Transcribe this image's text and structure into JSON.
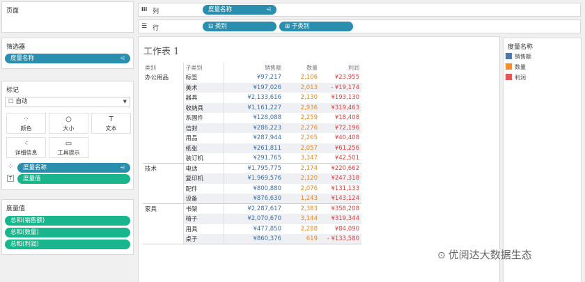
{
  "pages": {
    "title": "页面"
  },
  "filters": {
    "title": "筛选器",
    "pill": "度量名称",
    "sort": "⩤"
  },
  "marks": {
    "title": "标记",
    "type": "自动",
    "type_icon": "☐",
    "buttons": [
      {
        "label": "颜色",
        "icon": "⁘"
      },
      {
        "label": "大小",
        "icon": "○"
      },
      {
        "label": "文本",
        "icon": "T"
      },
      {
        "label": "详细信息",
        "icon": "⁖"
      },
      {
        "label": "工具提示",
        "icon": "▭"
      }
    ],
    "fields": [
      {
        "label": "度量名称",
        "icon": "⁘",
        "sort": "⩤"
      },
      {
        "label": "度量值",
        "icon": "T"
      }
    ]
  },
  "measure_values": {
    "title": "度量值",
    "items": [
      "总和(销售额)",
      "总和(数量)",
      "总和(利润)"
    ]
  },
  "shelves": {
    "columns": {
      "icon": "iii",
      "label": "列",
      "pills": [
        {
          "label": "度量名称",
          "sort": "⩤"
        }
      ]
    },
    "rows": {
      "icon": "☰",
      "label": "行",
      "pills": [
        {
          "label": "⊟ 类别"
        },
        {
          "label": "⊞ 子类别"
        }
      ]
    }
  },
  "sheet": {
    "title": "工作表 1",
    "headers": {
      "category": "类别",
      "subcategory": "子类别",
      "sales": "销售额",
      "quantity": "数量",
      "profit": "利润"
    },
    "groups": [
      {
        "category": "办公用品",
        "rows": [
          {
            "sub": "标签",
            "sales": "¥97,217",
            "qty": "2,106",
            "profit": "¥23,955"
          },
          {
            "sub": "美术",
            "sales": "¥197,026",
            "qty": "2,013",
            "profit": "- ¥19,174"
          },
          {
            "sub": "器具",
            "sales": "¥2,133,616",
            "qty": "2,130",
            "profit": "¥193,130"
          },
          {
            "sub": "收纳具",
            "sales": "¥1,161,227",
            "qty": "2,936",
            "profit": "¥319,463"
          },
          {
            "sub": "系固件",
            "sales": "¥128,088",
            "qty": "2,259",
            "profit": "¥18,408"
          },
          {
            "sub": "信封",
            "sales": "¥286,223",
            "qty": "2,276",
            "profit": "¥72,196"
          },
          {
            "sub": "用品",
            "sales": "¥287,944",
            "qty": "2,265",
            "profit": "¥40,408"
          },
          {
            "sub": "纸张",
            "sales": "¥261,811",
            "qty": "2,057",
            "profit": "¥61,256"
          },
          {
            "sub": "装订机",
            "sales": "¥291,765",
            "qty": "3,347",
            "profit": "¥42,501"
          }
        ]
      },
      {
        "category": "技术",
        "rows": [
          {
            "sub": "电话",
            "sales": "¥1,795,775",
            "qty": "2,174",
            "profit": "¥220,662"
          },
          {
            "sub": "复印机",
            "sales": "¥1,969,576",
            "qty": "2,120",
            "profit": "¥247,318"
          },
          {
            "sub": "配件",
            "sales": "¥800,880",
            "qty": "2,076",
            "profit": "¥131,133"
          },
          {
            "sub": "设备",
            "sales": "¥876,630",
            "qty": "1,243",
            "profit": "¥143,124"
          }
        ]
      },
      {
        "category": "家具",
        "rows": [
          {
            "sub": "书架",
            "sales": "¥2,287,617",
            "qty": "2,383",
            "profit": "¥358,208"
          },
          {
            "sub": "椅子",
            "sales": "¥2,070,670",
            "qty": "3,144",
            "profit": "¥319,344"
          },
          {
            "sub": "用具",
            "sales": "¥477,850",
            "qty": "2,288",
            "profit": "¥84,090"
          },
          {
            "sub": "桌子",
            "sales": "¥860,376",
            "qty": "619",
            "profit": "- ¥133,580"
          }
        ]
      }
    ]
  },
  "legend": {
    "title": "度量名称",
    "items": [
      {
        "label": "销售额",
        "color": "#4e79a7"
      },
      {
        "label": "数量",
        "color": "#f28e2b"
      },
      {
        "label": "利润",
        "color": "#e15759"
      }
    ]
  },
  "watermark": {
    "icon": "⊙",
    "text": "优阅达大数据生态"
  }
}
